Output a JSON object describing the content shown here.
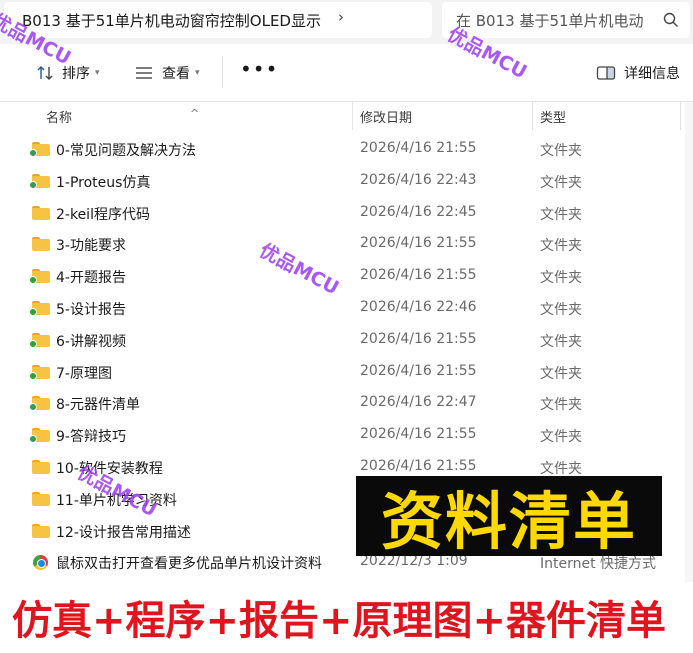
{
  "address_bar": {
    "path": "B013 基于51单片机电动窗帘控制OLED显示",
    "chevron": "›",
    "search_placeholder": "在 B013 基于51单片机电动"
  },
  "toolbar": {
    "sort_label": "排序",
    "view_label": "查看",
    "more_label": "•••",
    "details_label": "详细信息"
  },
  "columns": {
    "name": "名称",
    "date": "修改日期",
    "type": "类型"
  },
  "files": [
    {
      "name": "0-常见问题及解决方法",
      "date": "2026/4/16 21:55",
      "type": "文件夹",
      "icon": "folder-icon"
    },
    {
      "name": "1-Proteus仿真",
      "date": "2026/4/16 22:43",
      "type": "文件夹",
      "icon": "folder-icon"
    },
    {
      "name": "2-keil程序代码",
      "date": "2026/4/16 22:45",
      "type": "文件夹",
      "icon": "folder-icon"
    },
    {
      "name": "3-功能要求",
      "date": "2026/4/16 21:55",
      "type": "文件夹",
      "icon": "folder-icon"
    },
    {
      "name": "4-开题报告",
      "date": "2026/4/16 21:55",
      "type": "文件夹",
      "icon": "folder-icon"
    },
    {
      "name": "5-设计报告",
      "date": "2026/4/16 22:46",
      "type": "文件夹",
      "icon": "folder-icon"
    },
    {
      "name": "6-讲解视频",
      "date": "2026/4/16 21:55",
      "type": "文件夹",
      "icon": "folder-icon"
    },
    {
      "name": "7-原理图",
      "date": "2026/4/16 21:55",
      "type": "文件夹",
      "icon": "folder-icon"
    },
    {
      "name": "8-元器件清单",
      "date": "2026/4/16 22:47",
      "type": "文件夹",
      "icon": "folder-icon"
    },
    {
      "name": "9-答辩技巧",
      "date": "2026/4/16 21:55",
      "type": "文件夹",
      "icon": "folder-icon"
    },
    {
      "name": "10-软件安装教程",
      "date": "2026/4/16 21:55",
      "type": "文件夹",
      "icon": "folder-icon"
    },
    {
      "name": "11-单片机学习资料",
      "date": "",
      "type": "",
      "icon": "folder-icon"
    },
    {
      "name": "12-设计报告常用描述",
      "date": "",
      "type": "",
      "icon": "folder-icon"
    },
    {
      "name": "鼠标双击打开查看更多优品单片机设计资料",
      "date": "2022/12/3 1:09",
      "type": "Internet 快捷方式",
      "icon": "internet-shortcut-icon"
    }
  ],
  "watermark": "优品MCU",
  "promo": {
    "title": "资料清单",
    "bottom": "仿真+程序+报告+原理图+器件清单",
    "title_color": "#ffd800",
    "bottom_color": "#e0141e"
  }
}
